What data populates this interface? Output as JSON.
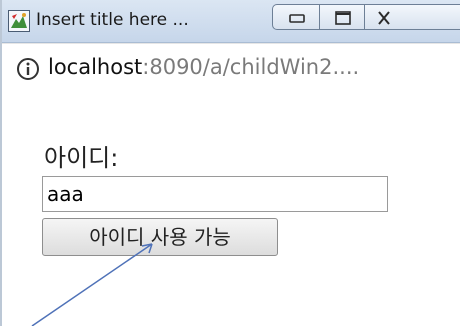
{
  "window": {
    "title": "Insert title here ...",
    "icon": "java-eclipse-icon",
    "controls": {
      "minimize": "minimize-icon",
      "maximize": "maximize-icon",
      "close": "close-icon"
    }
  },
  "address": {
    "icon": "info-icon",
    "host": "localhost",
    "rest": ":8090/a/childWin2...."
  },
  "form": {
    "id_label": "아이디:",
    "id_value": "aaa",
    "check_button_label": "아이디 사용 가능"
  },
  "colors": {
    "titlebar": "#c6d6ea",
    "annotation_arrow": "#4f72b8"
  }
}
